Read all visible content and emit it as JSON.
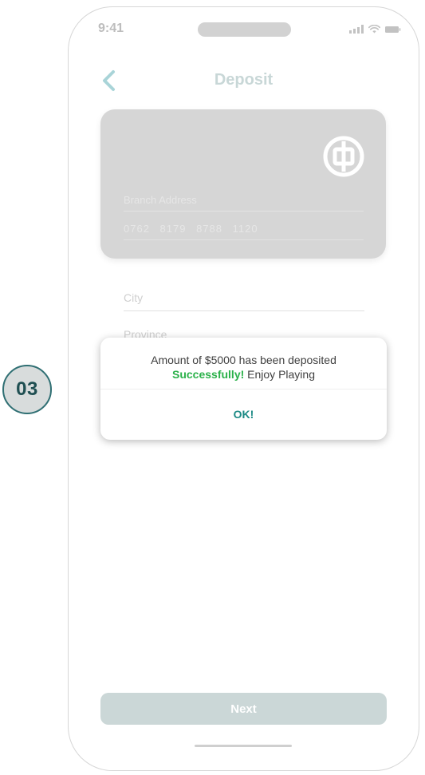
{
  "step_badge": {
    "label": "03"
  },
  "status_bar": {
    "time": "9:41",
    "icons": [
      "signal-icon",
      "wifi-icon",
      "battery-icon"
    ]
  },
  "header": {
    "back_icon": "chevron-left-icon",
    "title": "Deposit"
  },
  "card": {
    "logo_icon": "bank-logo-icon",
    "branch_placeholder": "Branch Address",
    "card_number": "0762   8179   8788   1120"
  },
  "form": {
    "city_placeholder": "City",
    "province_placeholder": "Province"
  },
  "dialog": {
    "line1": "Amount of $5000 has been deposited",
    "success_word": "Successfully!",
    "line2_rest": " Enjoy Playing",
    "ok_label": "OK!"
  },
  "footer": {
    "next_label": "Next"
  },
  "colors": {
    "accent": "#1c8a85",
    "success": "#2bb14a",
    "badge_border": "#2f6f73",
    "back_chevron": "#a9d4d8"
  }
}
